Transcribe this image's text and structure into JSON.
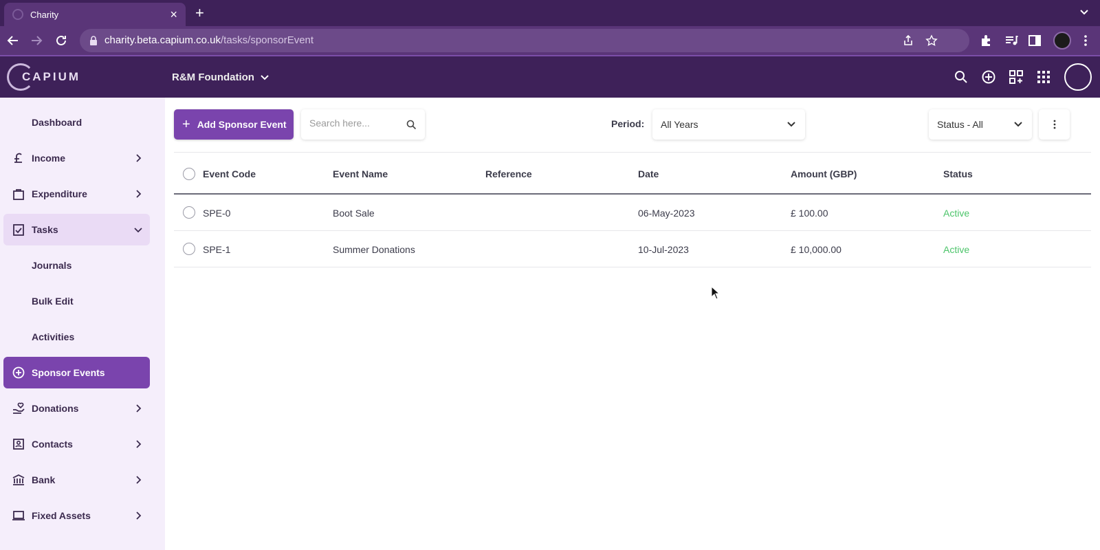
{
  "browser": {
    "tab_title": "Charity",
    "tab_close": "×",
    "new_tab": "+",
    "url_host": "charity.beta.capium.co.uk",
    "url_path": "/tasks/sponsorEvent"
  },
  "app": {
    "logo_text": "CAPIUM",
    "organization": "R&M Foundation"
  },
  "sidebar": {
    "items": [
      {
        "label": "Dashboard"
      },
      {
        "label": "Income"
      },
      {
        "label": "Expenditure"
      },
      {
        "label": "Tasks"
      },
      {
        "label": "Journals"
      },
      {
        "label": "Bulk Edit"
      },
      {
        "label": "Activities"
      },
      {
        "label": "Sponsor Events"
      },
      {
        "label": "Donations"
      },
      {
        "label": "Contacts"
      },
      {
        "label": "Bank"
      },
      {
        "label": "Fixed Assets"
      }
    ]
  },
  "toolbar": {
    "add_label": "Add Sponsor Event",
    "search_placeholder": "Search here...",
    "period_label": "Period:",
    "period_value": "All Years",
    "status_value": "Status - All"
  },
  "table": {
    "headers": [
      "Event Code",
      "Event Name",
      "Reference",
      "Date",
      "Amount (GBP)",
      "Status"
    ],
    "rows": [
      {
        "code": "SPE-0",
        "name": "Boot Sale",
        "reference": "",
        "date": "06-May-2023",
        "amount": "£ 100.00",
        "status": "Active"
      },
      {
        "code": "SPE-1",
        "name": "Summer Donations",
        "reference": "",
        "date": "10-Jul-2023",
        "amount": "£ 10,000.00",
        "status": "Active"
      }
    ]
  },
  "colors": {
    "brand_dark": "#3e2159",
    "brand_primary": "#7a44ad",
    "sidebar_bg": "#f5eefb",
    "status_active": "#4cc46a"
  }
}
